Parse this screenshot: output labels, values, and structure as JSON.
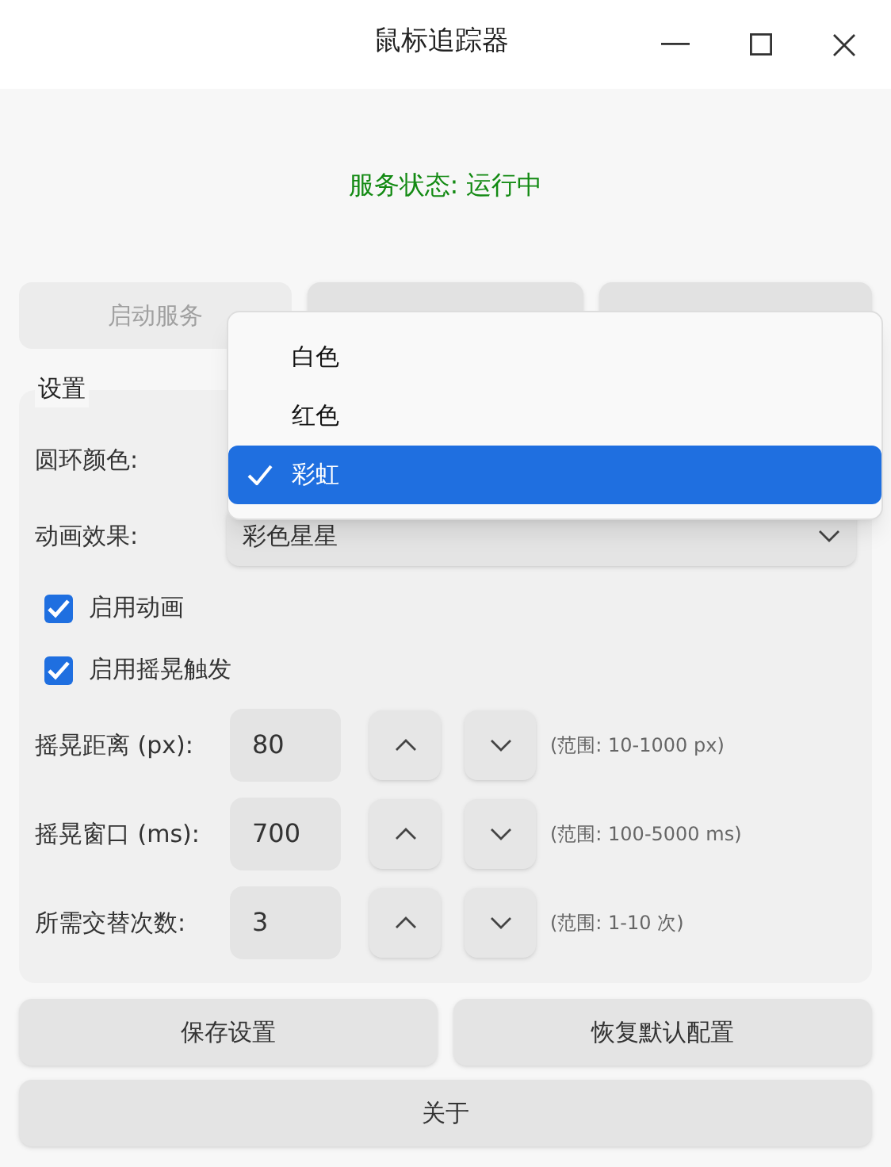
{
  "window": {
    "title": "鼠标追踪器"
  },
  "status": {
    "text": "服务状态: 运行中",
    "color": "#138a13"
  },
  "service_buttons": [
    {
      "label": "启动服务",
      "disabled": true
    }
  ],
  "settings": {
    "title": "设置",
    "ring_color": {
      "label": "圆环颜色:"
    },
    "animation": {
      "label": "动画效果:",
      "value": "彩色星星"
    },
    "checkboxes": [
      {
        "label": "启用动画",
        "checked": true
      },
      {
        "label": "启用摇晃触发",
        "checked": true
      }
    ],
    "spinners": [
      {
        "label": "摇晃距离 (px):",
        "value": "80",
        "hint": "(范围: 10-1000 px)"
      },
      {
        "label": "摇晃窗口 (ms):",
        "value": "700",
        "hint": "(范围: 100-5000 ms)"
      },
      {
        "label": "所需交替次数:",
        "value": "3",
        "hint": "(范围: 1-10 次)"
      }
    ]
  },
  "buttons": [
    "保存设置",
    "恢复默认配置"
  ],
  "about_button": "关于",
  "dropdown": {
    "options": [
      {
        "label": "白色",
        "selected": false
      },
      {
        "label": "红色",
        "selected": false
      },
      {
        "label": "彩虹",
        "selected": true
      }
    ]
  }
}
